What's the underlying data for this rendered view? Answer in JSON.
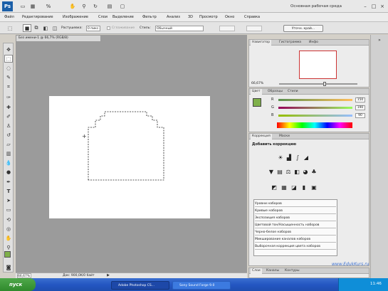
{
  "app": {
    "logo_text": "Ps"
  },
  "workspace": {
    "label": "Основная рабочая среда"
  },
  "menu": [
    "Файл",
    "Редактирование",
    "Изображение",
    "Слои",
    "Выделение",
    "Фильтр",
    "Анализ",
    "3D",
    "Просмотр",
    "Окно",
    "Справка"
  ],
  "options": {
    "feather_label": "Растушевка:",
    "feather_value": "0 пикс.",
    "smooth_label": "Сглаживание",
    "style_label": "Стиль:",
    "style_value": "Обычный",
    "refine_button": "Уточн. край..."
  },
  "document": {
    "tab_title": "Без имени-1 @ 66,7% (RGB/8)"
  },
  "status": {
    "zoom": "66,67%",
    "doc_info": "Док: 900,0K/0 байт"
  },
  "navigator": {
    "tabs": [
      "Навигатор",
      "Гистограмма",
      "Инфо"
    ],
    "zoom": "66,67%"
  },
  "color": {
    "tabs": [
      "Цвет",
      "Образцы",
      "Стили"
    ],
    "channels": [
      {
        "label": "R",
        "value": "150"
      },
      {
        "label": "G",
        "value": "190"
      },
      {
        "label": "B",
        "value": "90"
      }
    ],
    "fg_color": "#7fb04a",
    "bg_color": "#000000"
  },
  "adjustments": {
    "tabs": [
      "Коррекция",
      "Маски"
    ],
    "heading": "Добавить коррекцию",
    "presets": [
      "Уровни наборов",
      "Кривые наборов",
      "Экспозиция наборов",
      "Цветовой тон/Насыщенность наборов",
      "Черно-белое наборов",
      "Микширование каналов наборов",
      "Выборочная коррекция цвета наборов"
    ]
  },
  "layers": {
    "tabs": [
      "Слои",
      "Каналы",
      "Контуры"
    ]
  },
  "watermark": "www.EdukKurs.ru",
  "taskbar": {
    "start": "пуск",
    "tasks": [
      "Adobe Photoshop CS...",
      "Sony Sound Forge 9.0"
    ],
    "clock": "11:46"
  }
}
